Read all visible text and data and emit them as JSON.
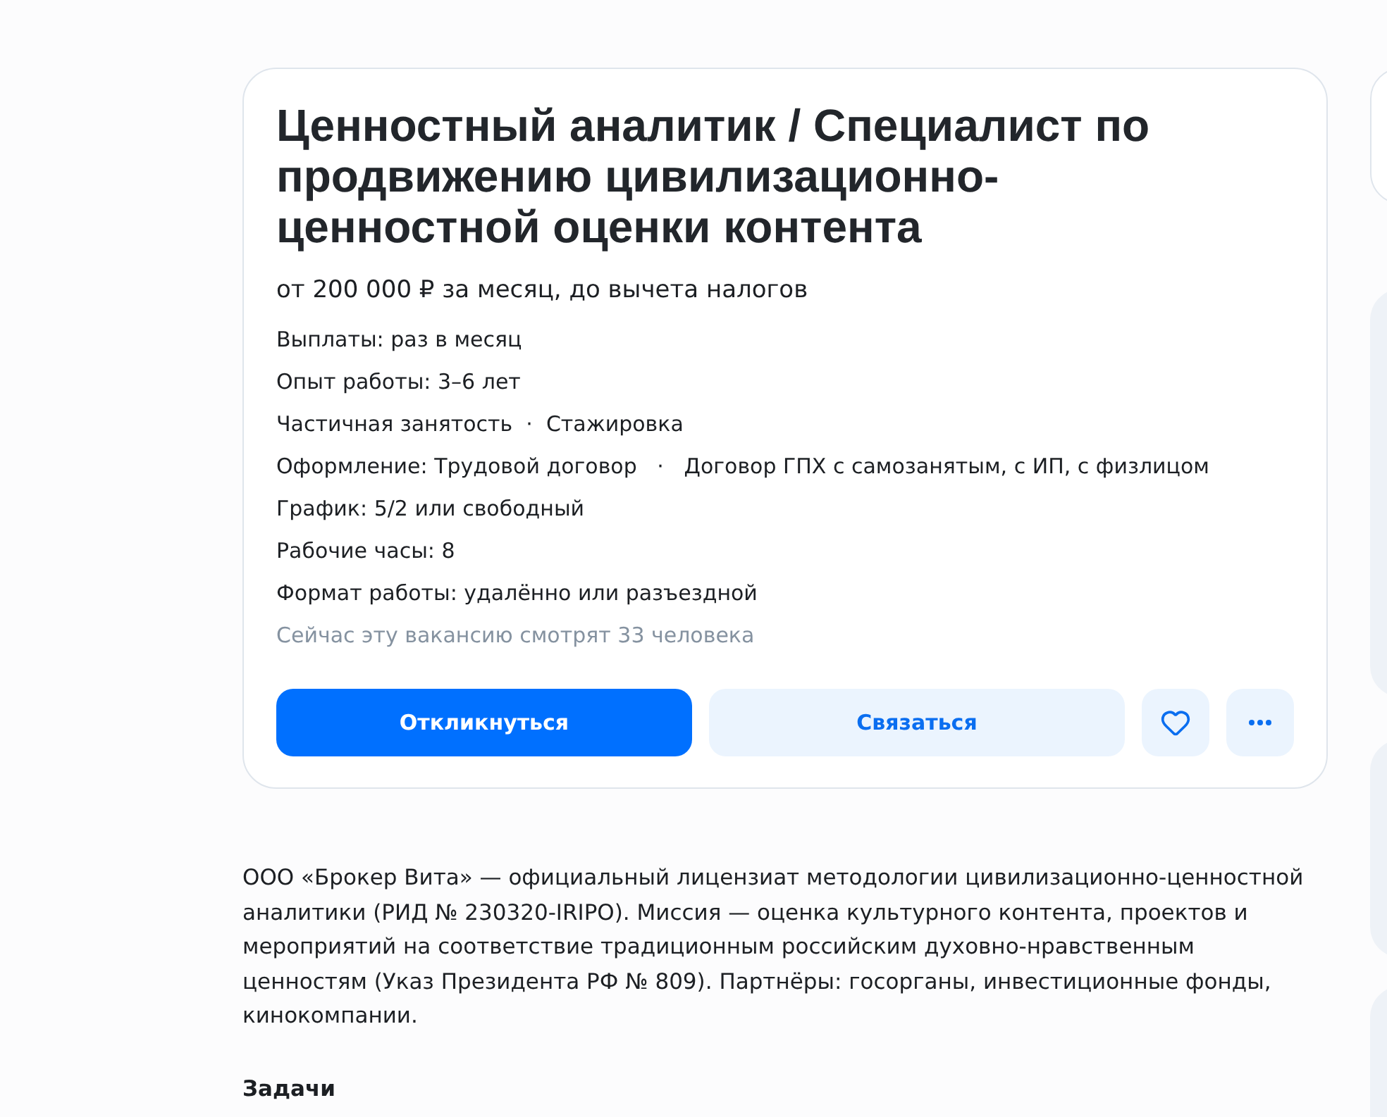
{
  "vacancy": {
    "title": "Ценностный аналитик / Специалист по продвижению цивилизационно-ценностной оценки контента",
    "salary": "от 200 000 ₽ за месяц, до вычета налогов",
    "details": [
      "Выплаты: раз в месяц",
      "Опыт работы: 3–6 лет",
      "Частичная занятость  ·  Стажировка",
      "Оформление: Трудовой договор   ·   Договор ГПХ с самозанятым, с ИП, с физлицом",
      "График: 5/2 или свободный",
      "Рабочие часы: 8",
      "Формат работы: удалённо или разъездной"
    ],
    "viewers": "Сейчас эту вакансию смотрят 33 человека",
    "actions": [
      {
        "kind": "primary",
        "label": "Откликнуться"
      },
      {
        "kind": "secondary",
        "label": "Связаться"
      },
      {
        "kind": "favorite"
      },
      {
        "kind": "more"
      }
    ]
  },
  "description": {
    "paragraph": "ООО «Брокер Вита» — официальный лицензиат методологии цивилизационно-ценностной аналитики (РИД № 230320-IRIPO). Миссия — оценка культурного контента, проектов и мероприятий на соответствие традиционным российским духовно-нравственным ценностям (Указ Президента РФ № 809). Партнёры: госорганы, инвестиционные фонды, кинокомпании.",
    "heading": "Задачи"
  },
  "side_cards": [
    {
      "kind": "outlined"
    },
    {
      "kind": "filled"
    },
    {
      "kind": "filled"
    },
    {
      "kind": "filled"
    }
  ]
}
